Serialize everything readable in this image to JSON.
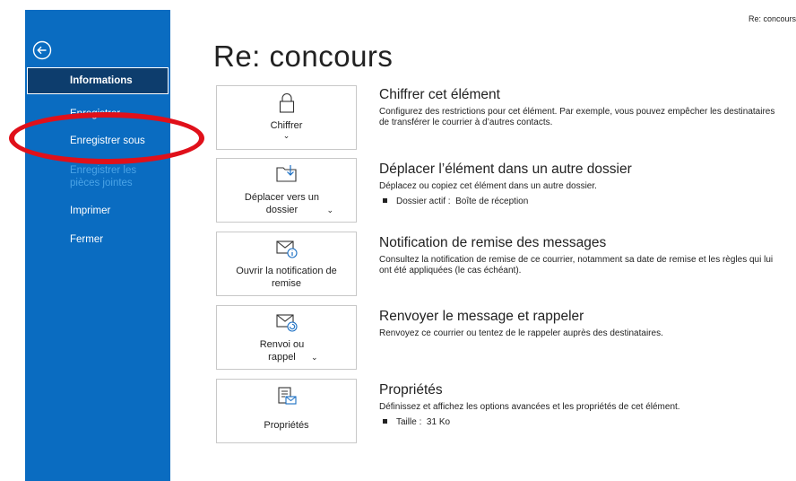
{
  "window": {
    "topline_title": "Re: concours"
  },
  "sidebar": {
    "items": [
      {
        "label": "Informations"
      },
      {
        "label": "Enregistrer"
      },
      {
        "label": "Enregistrer sous"
      },
      {
        "label": "Enregistrer les pièces jointes"
      },
      {
        "label": "Imprimer"
      },
      {
        "label": "Fermer"
      }
    ]
  },
  "page": {
    "title": "Re: concours"
  },
  "sections": [
    {
      "button_label": "Chiffrer",
      "heading": "Chiffrer cet élément",
      "description": "Configurez des restrictions pour cet élément. Par exemple, vous pouvez empêcher les destinataires de transférer le courrier à d’autres contacts."
    },
    {
      "button_label": "Déplacer vers un dossier",
      "heading": "Déplacer l’élément dans un autre dossier",
      "description": "Déplacez ou copiez cet élément dans un autre dossier.",
      "bullet_label": "Dossier actif :",
      "bullet_value": "Boîte de réception"
    },
    {
      "button_label": "Ouvrir la notification de remise",
      "heading": "Notification de remise des messages",
      "description": "Consultez la notification de remise de ce courrier, notamment sa date de remise et les règles qui lui ont été appliquées (le cas échéant)."
    },
    {
      "button_label": "Renvoi ou rappel",
      "heading": "Renvoyer le message et rappeler",
      "description": "Renvoyez ce courrier ou tentez de le rappeler auprès des destinataires."
    },
    {
      "button_label": "Propriétés",
      "heading": "Propriétés",
      "description": "Définissez et affichez les options avancées et les propriétés de cet élément.",
      "bullet_label": "Taille :",
      "bullet_value": "31 Ko"
    }
  ],
  "colors": {
    "sidebar": "#0a6cc1",
    "sidebar_active": "#0d3d6d",
    "annotation": "#e0101a"
  },
  "icons": {
    "back": "back-arrow-icon",
    "chiffrer": "lock-icon",
    "deplacer": "folder-move-icon",
    "notification": "mail-info-icon",
    "renvoi": "mail-resend-icon",
    "proprietes": "properties-icon"
  }
}
